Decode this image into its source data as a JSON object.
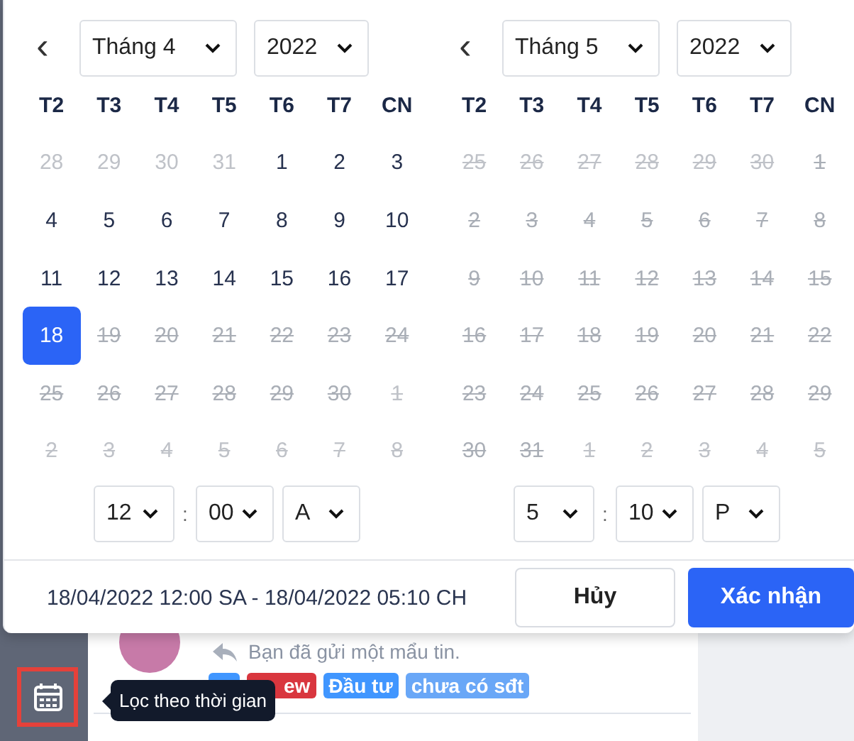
{
  "calendars": [
    {
      "prev": "‹",
      "month": "Tháng 4",
      "year": "2022",
      "weekdays": [
        "T2",
        "T3",
        "T4",
        "T5",
        "T6",
        "T7",
        "CN"
      ],
      "days": [
        {
          "label": "28",
          "muted": true,
          "disabled": false,
          "selected": false
        },
        {
          "label": "29",
          "muted": true,
          "disabled": false,
          "selected": false
        },
        {
          "label": "30",
          "muted": true,
          "disabled": false,
          "selected": false
        },
        {
          "label": "31",
          "muted": true,
          "disabled": false,
          "selected": false
        },
        {
          "label": "1",
          "muted": false,
          "disabled": false,
          "selected": false
        },
        {
          "label": "2",
          "muted": false,
          "disabled": false,
          "selected": false
        },
        {
          "label": "3",
          "muted": false,
          "disabled": false,
          "selected": false
        },
        {
          "label": "4",
          "muted": false,
          "disabled": false,
          "selected": false
        },
        {
          "label": "5",
          "muted": false,
          "disabled": false,
          "selected": false
        },
        {
          "label": "6",
          "muted": false,
          "disabled": false,
          "selected": false
        },
        {
          "label": "7",
          "muted": false,
          "disabled": false,
          "selected": false
        },
        {
          "label": "8",
          "muted": false,
          "disabled": false,
          "selected": false
        },
        {
          "label": "9",
          "muted": false,
          "disabled": false,
          "selected": false
        },
        {
          "label": "10",
          "muted": false,
          "disabled": false,
          "selected": false
        },
        {
          "label": "11",
          "muted": false,
          "disabled": false,
          "selected": false
        },
        {
          "label": "12",
          "muted": false,
          "disabled": false,
          "selected": false
        },
        {
          "label": "13",
          "muted": false,
          "disabled": false,
          "selected": false
        },
        {
          "label": "14",
          "muted": false,
          "disabled": false,
          "selected": false
        },
        {
          "label": "15",
          "muted": false,
          "disabled": false,
          "selected": false
        },
        {
          "label": "16",
          "muted": false,
          "disabled": false,
          "selected": false
        },
        {
          "label": "17",
          "muted": false,
          "disabled": false,
          "selected": false
        },
        {
          "label": "18",
          "muted": false,
          "disabled": false,
          "selected": true
        },
        {
          "label": "19",
          "muted": false,
          "disabled": true,
          "selected": false
        },
        {
          "label": "20",
          "muted": false,
          "disabled": true,
          "selected": false
        },
        {
          "label": "21",
          "muted": false,
          "disabled": true,
          "selected": false
        },
        {
          "label": "22",
          "muted": false,
          "disabled": true,
          "selected": false
        },
        {
          "label": "23",
          "muted": false,
          "disabled": true,
          "selected": false
        },
        {
          "label": "24",
          "muted": false,
          "disabled": true,
          "selected": false
        },
        {
          "label": "25",
          "muted": false,
          "disabled": true,
          "selected": false
        },
        {
          "label": "26",
          "muted": false,
          "disabled": true,
          "selected": false
        },
        {
          "label": "27",
          "muted": false,
          "disabled": true,
          "selected": false
        },
        {
          "label": "28",
          "muted": false,
          "disabled": true,
          "selected": false
        },
        {
          "label": "29",
          "muted": false,
          "disabled": true,
          "selected": false
        },
        {
          "label": "30",
          "muted": false,
          "disabled": true,
          "selected": false
        },
        {
          "label": "1",
          "muted": true,
          "disabled": true,
          "selected": false
        },
        {
          "label": "2",
          "muted": true,
          "disabled": true,
          "selected": false
        },
        {
          "label": "3",
          "muted": true,
          "disabled": true,
          "selected": false
        },
        {
          "label": "4",
          "muted": true,
          "disabled": true,
          "selected": false
        },
        {
          "label": "5",
          "muted": true,
          "disabled": true,
          "selected": false
        },
        {
          "label": "6",
          "muted": true,
          "disabled": true,
          "selected": false
        },
        {
          "label": "7",
          "muted": true,
          "disabled": true,
          "selected": false
        },
        {
          "label": "8",
          "muted": true,
          "disabled": true,
          "selected": false
        }
      ],
      "time": {
        "hour": "12",
        "minute": "00",
        "period": "A",
        "separator": ":"
      }
    },
    {
      "prev": "‹",
      "month": "Tháng 5",
      "year": "2022",
      "weekdays": [
        "T2",
        "T3",
        "T4",
        "T5",
        "T6",
        "T7",
        "CN"
      ],
      "days": [
        {
          "label": "25",
          "muted": true,
          "disabled": true,
          "selected": false
        },
        {
          "label": "26",
          "muted": true,
          "disabled": true,
          "selected": false
        },
        {
          "label": "27",
          "muted": true,
          "disabled": true,
          "selected": false
        },
        {
          "label": "28",
          "muted": true,
          "disabled": true,
          "selected": false
        },
        {
          "label": "29",
          "muted": true,
          "disabled": true,
          "selected": false
        },
        {
          "label": "30",
          "muted": true,
          "disabled": true,
          "selected": false
        },
        {
          "label": "1",
          "muted": false,
          "disabled": true,
          "selected": false
        },
        {
          "label": "2",
          "muted": false,
          "disabled": true,
          "selected": false
        },
        {
          "label": "3",
          "muted": false,
          "disabled": true,
          "selected": false
        },
        {
          "label": "4",
          "muted": false,
          "disabled": true,
          "selected": false
        },
        {
          "label": "5",
          "muted": false,
          "disabled": true,
          "selected": false
        },
        {
          "label": "6",
          "muted": false,
          "disabled": true,
          "selected": false
        },
        {
          "label": "7",
          "muted": false,
          "disabled": true,
          "selected": false
        },
        {
          "label": "8",
          "muted": false,
          "disabled": true,
          "selected": false
        },
        {
          "label": "9",
          "muted": false,
          "disabled": true,
          "selected": false
        },
        {
          "label": "10",
          "muted": false,
          "disabled": true,
          "selected": false
        },
        {
          "label": "11",
          "muted": false,
          "disabled": true,
          "selected": false
        },
        {
          "label": "12",
          "muted": false,
          "disabled": true,
          "selected": false
        },
        {
          "label": "13",
          "muted": false,
          "disabled": true,
          "selected": false
        },
        {
          "label": "14",
          "muted": false,
          "disabled": true,
          "selected": false
        },
        {
          "label": "15",
          "muted": false,
          "disabled": true,
          "selected": false
        },
        {
          "label": "16",
          "muted": false,
          "disabled": true,
          "selected": false
        },
        {
          "label": "17",
          "muted": false,
          "disabled": true,
          "selected": false
        },
        {
          "label": "18",
          "muted": false,
          "disabled": true,
          "selected": false
        },
        {
          "label": "19",
          "muted": false,
          "disabled": true,
          "selected": false
        },
        {
          "label": "20",
          "muted": false,
          "disabled": true,
          "selected": false
        },
        {
          "label": "21",
          "muted": false,
          "disabled": true,
          "selected": false
        },
        {
          "label": "22",
          "muted": false,
          "disabled": true,
          "selected": false
        },
        {
          "label": "23",
          "muted": false,
          "disabled": true,
          "selected": false
        },
        {
          "label": "24",
          "muted": false,
          "disabled": true,
          "selected": false
        },
        {
          "label": "25",
          "muted": false,
          "disabled": true,
          "selected": false
        },
        {
          "label": "26",
          "muted": false,
          "disabled": true,
          "selected": false
        },
        {
          "label": "27",
          "muted": false,
          "disabled": true,
          "selected": false
        },
        {
          "label": "28",
          "muted": false,
          "disabled": true,
          "selected": false
        },
        {
          "label": "29",
          "muted": false,
          "disabled": true,
          "selected": false
        },
        {
          "label": "30",
          "muted": false,
          "disabled": true,
          "selected": false
        },
        {
          "label": "31",
          "muted": false,
          "disabled": true,
          "selected": false
        },
        {
          "label": "1",
          "muted": true,
          "disabled": true,
          "selected": false
        },
        {
          "label": "2",
          "muted": true,
          "disabled": true,
          "selected": false
        },
        {
          "label": "3",
          "muted": true,
          "disabled": true,
          "selected": false
        },
        {
          "label": "4",
          "muted": true,
          "disabled": true,
          "selected": false
        },
        {
          "label": "5",
          "muted": true,
          "disabled": true,
          "selected": false
        }
      ],
      "time": {
        "hour": "5",
        "minute": "10",
        "period": "P",
        "separator": ":"
      }
    }
  ],
  "footer": {
    "range": "18/04/2022 12:00 SA - 18/04/2022 05:10 CH",
    "cancel": "Hủy",
    "confirm": "Xác nhận"
  },
  "background": {
    "message": "Bạn đã gửi một mẩu tin.",
    "tags": [
      {
        "color": "#4096ff"
      },
      {
        "label": "ew",
        "color": "#d9363e"
      },
      {
        "label": "Đầu tư",
        "color": "#4096ff"
      },
      {
        "label": "chưa có sđt",
        "color": "#69a7f7"
      }
    ],
    "tooltip": "Lọc theo thời gian"
  }
}
